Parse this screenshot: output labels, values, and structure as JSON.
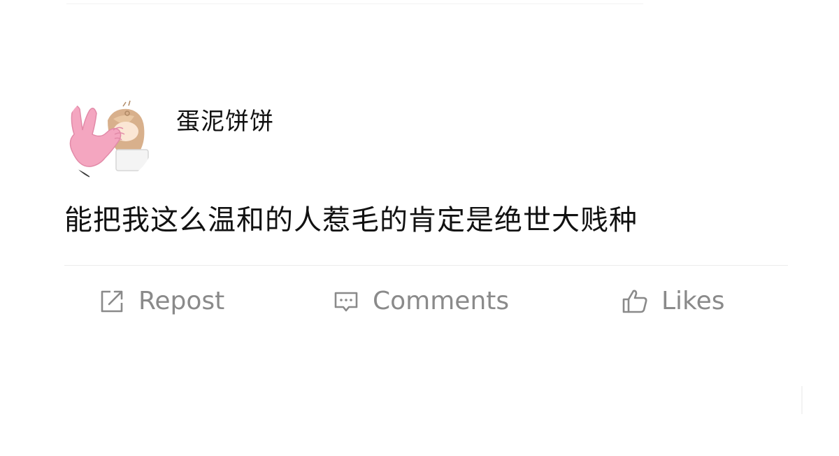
{
  "post": {
    "username": "蛋泥饼饼",
    "avatar_icon": "cartoon-rabbit-avatar",
    "text": "能把我这么温和的人惹毛的肯定是绝世大贱种"
  },
  "actions": [
    {
      "label": "Repost",
      "icon": "repost-icon"
    },
    {
      "label": "Comments",
      "icon": "comment-icon"
    },
    {
      "label": "Likes",
      "icon": "thumbs-up-icon"
    }
  ],
  "colors": {
    "background": "#ffffff",
    "text": "#111111",
    "action_gray": "#8a8a8a",
    "divider": "#ececec",
    "avatar_pink": "#f4a6c0",
    "avatar_hair": "#d8b08c"
  }
}
